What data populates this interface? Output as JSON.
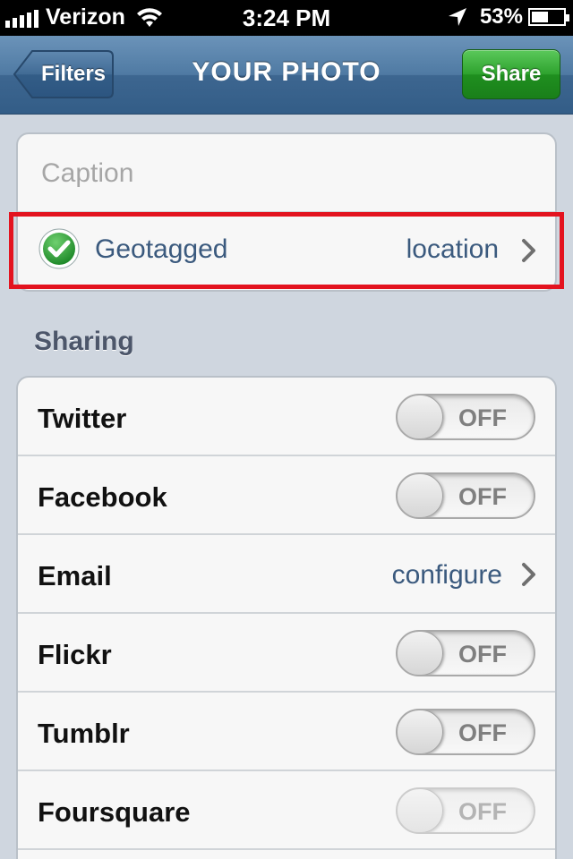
{
  "status_bar": {
    "carrier": "Verizon",
    "time": "3:24 PM",
    "battery_percent": "53",
    "battery_symbol": "%",
    "battery_level": 0.53
  },
  "nav": {
    "back_label": "Filters",
    "title": "YOUR PHOTO",
    "share_label": "Share"
  },
  "caption": {
    "placeholder": "Caption"
  },
  "geotag": {
    "label": "Geotagged",
    "value": "location",
    "checked": true
  },
  "sharing": {
    "header": "Sharing",
    "items": [
      {
        "name": "Twitter",
        "state": "OFF"
      },
      {
        "name": "Facebook",
        "state": "OFF"
      },
      {
        "name": "Email",
        "value": "configure"
      },
      {
        "name": "Flickr",
        "state": "OFF"
      },
      {
        "name": "Tumblr",
        "state": "OFF"
      },
      {
        "name": "Foursquare",
        "state": "OFF",
        "disabled": true
      }
    ]
  },
  "colors": {
    "nav_blue": "#4f7aa3",
    "share_green": "#2ea22e",
    "highlight_red": "#e3131f",
    "link_blue": "#3b5a7e"
  }
}
